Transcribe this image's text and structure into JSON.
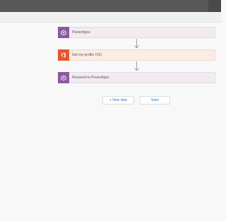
{
  "flow": {
    "steps": [
      {
        "label": "PowerApps",
        "icon": "powerapps-icon",
        "color": "#8c59a0",
        "more": "···"
      },
      {
        "label": "Get my profile (V2)",
        "icon": "office365-icon",
        "color": "#e8572d",
        "more": "···"
      },
      {
        "label": "Respond to PowerApps",
        "icon": "powerapps-icon",
        "color": "#8c59a0",
        "more": "···"
      }
    ]
  },
  "actions": {
    "new_step": "+ New step",
    "save": "Save"
  },
  "colors": {
    "topbar": "#585858",
    "link": "#2f77c2"
  }
}
